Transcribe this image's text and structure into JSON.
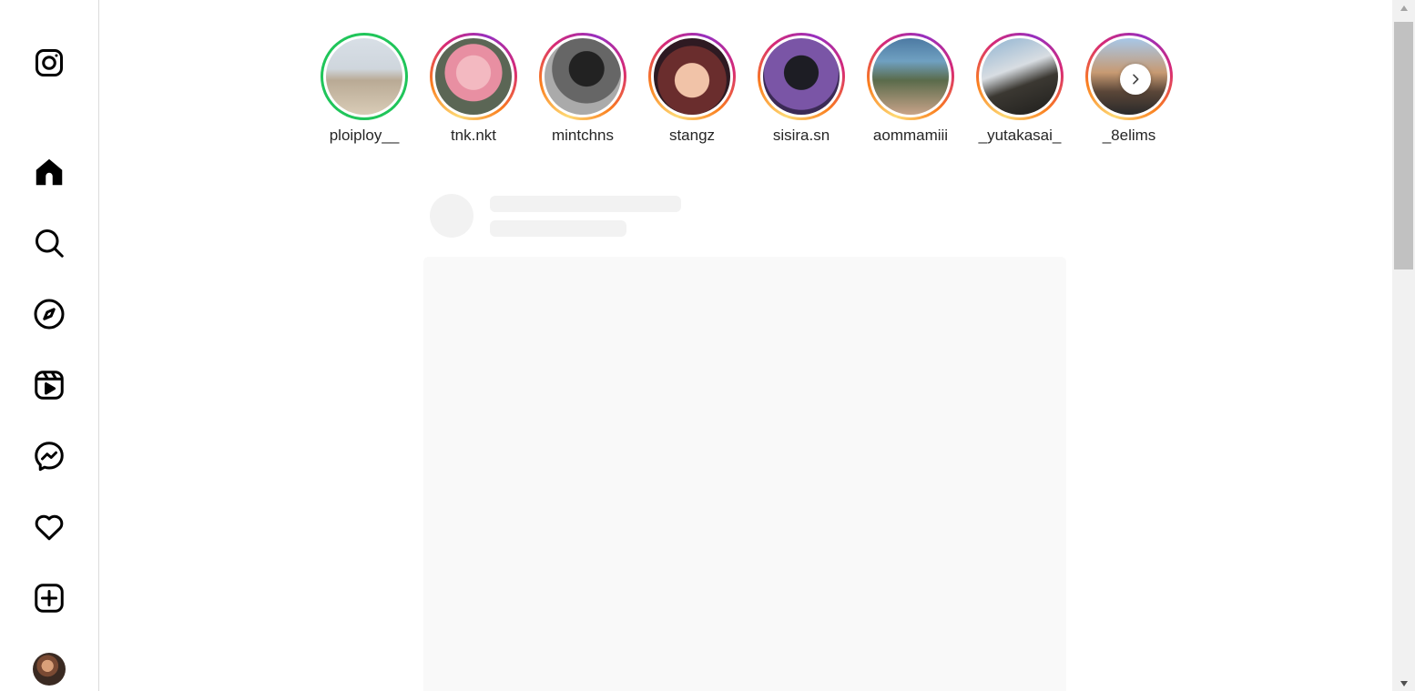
{
  "sidebar": {
    "items": [
      {
        "name": "instagram-logo"
      },
      {
        "name": "home-icon"
      },
      {
        "name": "search-icon"
      },
      {
        "name": "explore-icon"
      },
      {
        "name": "reels-icon"
      },
      {
        "name": "messenger-icon"
      },
      {
        "name": "heart-icon"
      },
      {
        "name": "create-icon"
      },
      {
        "name": "profile-avatar"
      }
    ]
  },
  "stories": [
    {
      "username": "ploiploy__",
      "ring": "close-friends"
    },
    {
      "username": "tnk.nkt",
      "ring": "gradient"
    },
    {
      "username": "mintchns",
      "ring": "gradient"
    },
    {
      "username": "stangz",
      "ring": "gradient"
    },
    {
      "username": "sisira.sn",
      "ring": "gradient"
    },
    {
      "username": "aommamiii",
      "ring": "gradient"
    },
    {
      "username": "_yutakasai_",
      "ring": "gradient"
    },
    {
      "username": "_8elims",
      "ring": "gradient"
    }
  ],
  "colors": {
    "close_friends_ring": "#20c55a",
    "story_ring_gradient": [
      "#feda75",
      "#fa7e1e",
      "#d62976",
      "#962fbf"
    ],
    "skeleton": "#f2f2f2",
    "border": "#dbdbdb"
  }
}
